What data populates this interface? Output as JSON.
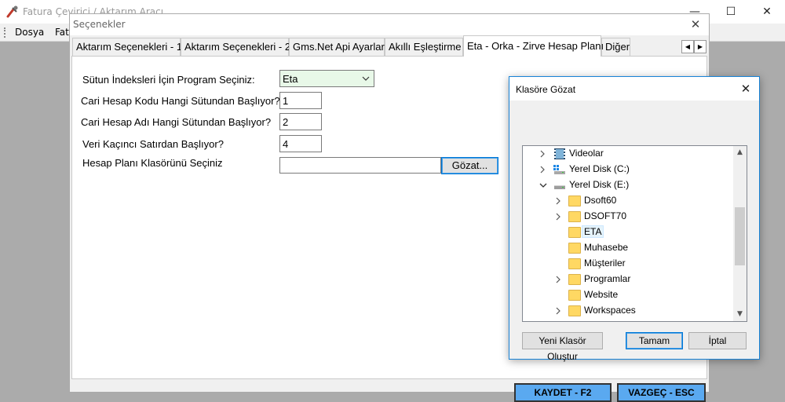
{
  "app": {
    "title": "Fatura Çevirici / Aktarım Aracı",
    "menu": [
      "Dosya",
      "Fat"
    ]
  },
  "options": {
    "title": "Seçenekler",
    "tabs": [
      "Aktarım Seçenekleri - 1",
      "Aktarım Seçenekleri - 2",
      "Gms.Net Api Ayarları",
      "Akıllı Eşleştirme",
      "Eta - Orka - Zirve Hesap Planı",
      "Diğer"
    ],
    "active_tab": 4,
    "form": {
      "program_label": "Sütun İndeksleri İçin Program Seçiniz:",
      "program_value": "Eta",
      "code_col_label": "Cari Hesap Kodu Hangi Sütundan Başlıyor?",
      "code_col_value": "1",
      "name_col_label": "Cari Hesap Adı Hangi Sütundan Başlıyor?",
      "name_col_value": "2",
      "row_label": "Veri Kaçıncı Satırdan Başlıyor?",
      "row_value": "4",
      "folder_label": "Hesap Planı Klasörünü Seçiniz",
      "folder_value": "",
      "browse_label": "Gözat..."
    },
    "save_label": "KAYDET - F2",
    "cancel_label": "VAZGEÇ - ESC"
  },
  "folder_browser": {
    "title": "Klasöre Gözat",
    "items": [
      {
        "label": "Videolar",
        "chevron": "right",
        "icon": "video-library-icon"
      },
      {
        "label": "Yerel Disk (C:)",
        "chevron": "right",
        "icon": "drive-icon"
      },
      {
        "label": "Yerel Disk (E:)",
        "chevron": "down",
        "icon": "drive-icon"
      },
      {
        "label": "Dsoft60",
        "chevron": "right",
        "icon": "folder-icon"
      },
      {
        "label": "DSOFT70",
        "chevron": "right",
        "icon": "folder-icon"
      },
      {
        "label": "ETA",
        "chevron": "",
        "icon": "folder-icon",
        "selected": true
      },
      {
        "label": "Muhasebe",
        "chevron": "",
        "icon": "folder-icon"
      },
      {
        "label": "Müşteriler",
        "chevron": "",
        "icon": "folder-icon"
      },
      {
        "label": "Programlar",
        "chevron": "right",
        "icon": "folder-icon"
      },
      {
        "label": "Website",
        "chevron": "",
        "icon": "folder-icon"
      },
      {
        "label": "Workspaces",
        "chevron": "right",
        "icon": "folder-icon"
      }
    ],
    "new_folder_label": "Yeni Klasör Oluştur",
    "ok_label": "Tamam",
    "cancel_label": "İptal"
  }
}
